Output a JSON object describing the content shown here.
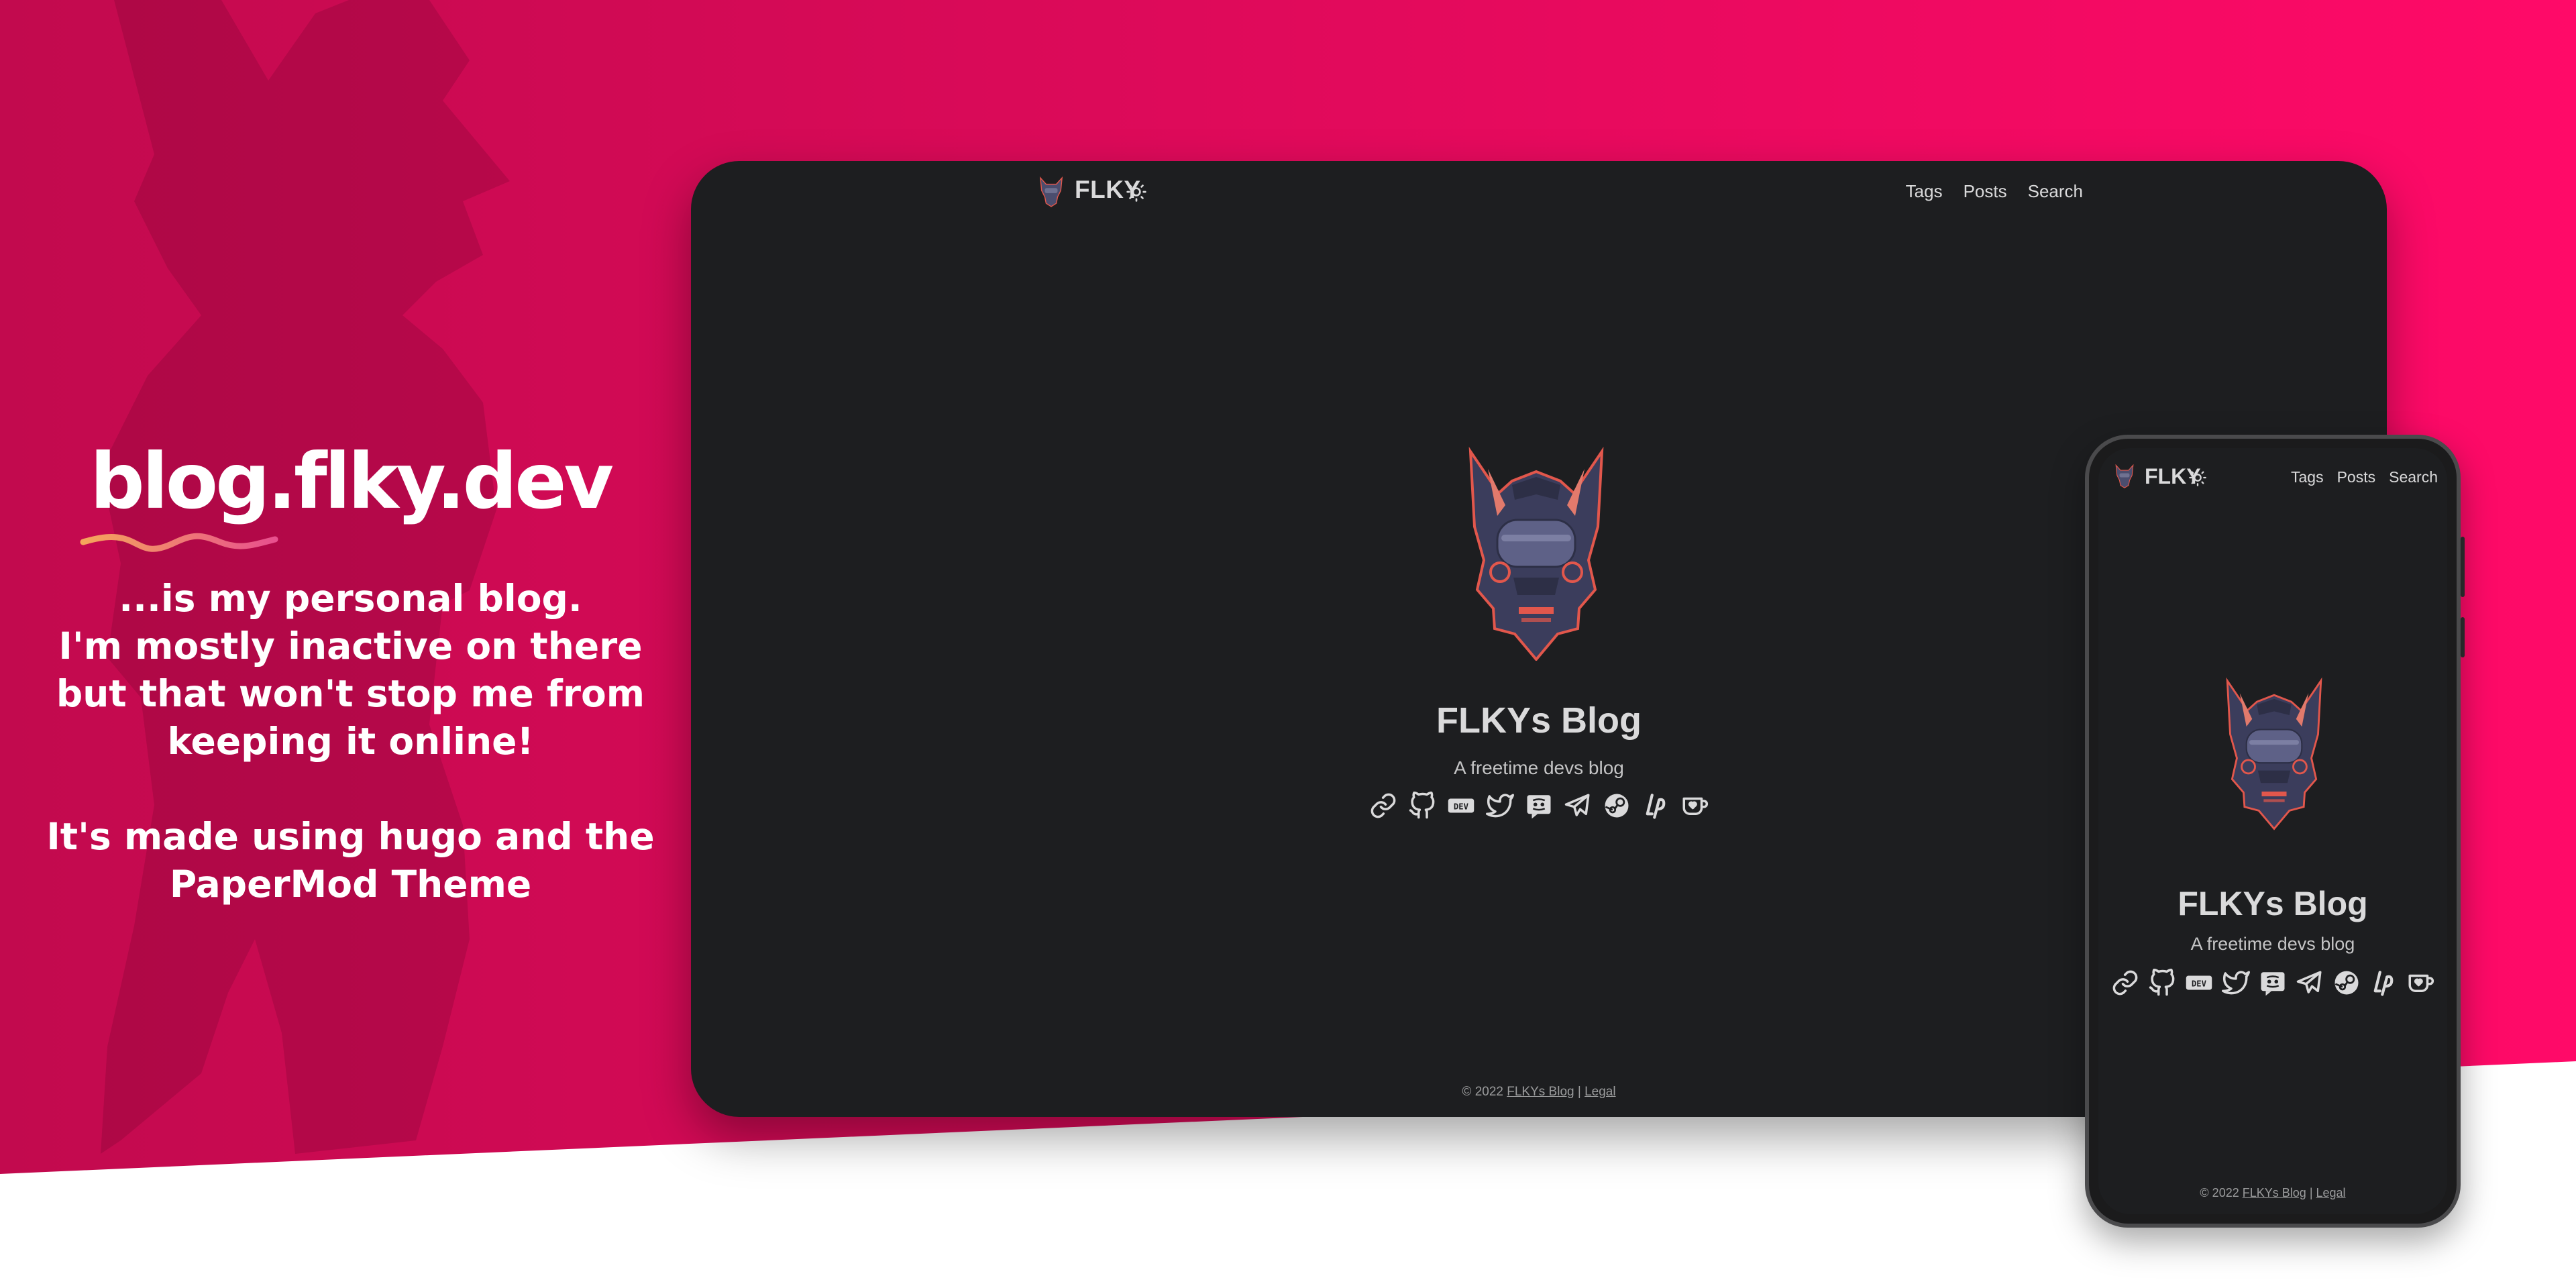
{
  "colors": {
    "bg_gradient_start": "#c20a4e",
    "bg_gradient_end": "#ff0a68",
    "site_background": "#1d1e20",
    "site_text": "#dadadb",
    "squiggle_start": "#f5a65b",
    "squiggle_end": "#e8508e"
  },
  "promo": {
    "domain": "blog.flky.dev",
    "description": "...is my personal blog.\nI'm mostly inactive on there\nbut that won't stop me from\nkeeping it online!\n\nIt's made using hugo and the\nPaperMod Theme"
  },
  "site": {
    "logo_text": "FLKY",
    "theme_toggle_icon": "sun-icon",
    "nav": [
      "Tags",
      "Posts",
      "Search"
    ],
    "title": "FLKYs Blog",
    "subtitle": "A freetime devs blog",
    "social_icons": [
      "link-icon",
      "github-icon",
      "dev-icon",
      "twitter-icon",
      "discord-icon",
      "telegram-icon",
      "steam-icon",
      "liberapay-icon",
      "kofi-icon"
    ],
    "footer": {
      "copyright": "© 2022",
      "blog_link": "FLKYs Blog",
      "separator": "|",
      "legal_link": "Legal"
    }
  }
}
